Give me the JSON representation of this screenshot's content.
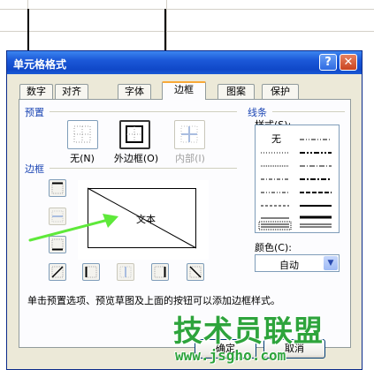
{
  "dialog": {
    "title": "单元格格式"
  },
  "titlebar": {
    "help_glyph": "?",
    "close_glyph": "✕"
  },
  "tabs": [
    {
      "label": "数字",
      "active": false
    },
    {
      "label": "对齐",
      "active": false
    },
    {
      "label": "字体",
      "active": false
    },
    {
      "label": "边框",
      "active": true
    },
    {
      "label": "图案",
      "active": false
    },
    {
      "label": "保护",
      "active": false
    }
  ],
  "presets": {
    "group_label": "预置",
    "items": [
      {
        "label": "无(N)",
        "selected": false,
        "disabled": false
      },
      {
        "label": "外边框(O)",
        "selected": true,
        "disabled": false
      },
      {
        "label": "内部(I)",
        "selected": false,
        "disabled": true
      }
    ]
  },
  "border": {
    "group_label": "边框",
    "preview_text": "文本",
    "diagonal": "down"
  },
  "line": {
    "group_label": "线条",
    "style_label": "样式(S):",
    "none_label": "无",
    "color_label": "颜色(C):",
    "color_value": "自动"
  },
  "hint": "单击预置选项、预览草图及上面的按钮可以添加边框样式。",
  "buttons": {
    "ok": "确定",
    "cancel": "取消"
  },
  "watermark": {
    "text": "技术员联盟",
    "url": "www.jsgho.com"
  },
  "colors": {
    "arrow": "#5ee93a",
    "title_bar": "#1b58d8",
    "selection": "#f9a937"
  }
}
